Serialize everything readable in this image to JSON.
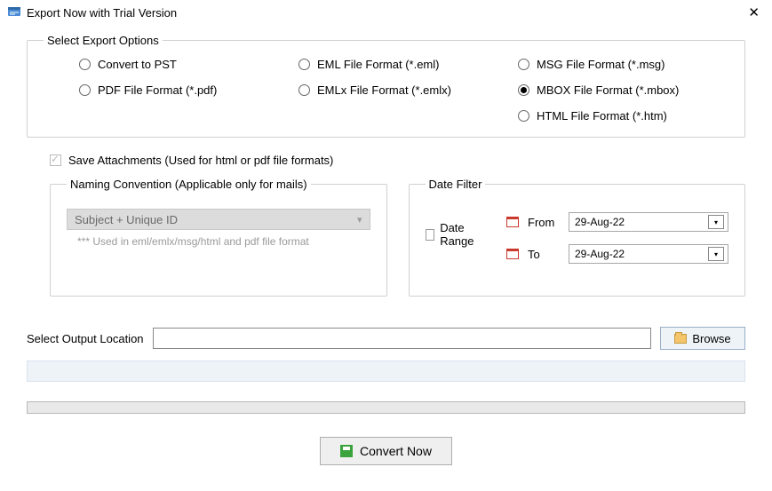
{
  "window": {
    "title": "Export Now with Trial Version"
  },
  "export": {
    "legend": "Select Export Options",
    "opts": {
      "pst": "Convert to PST",
      "pdf": "PDF File Format (*.pdf)",
      "eml": "EML File  Format (*.eml)",
      "emlx": "EMLx File  Format (*.emlx)",
      "msg": "MSG File Format (*.msg)",
      "mbox": "MBOX File Format (*.mbox)",
      "html": "HTML File  Format (*.htm)"
    }
  },
  "attachments": {
    "label": "Save Attachments (Used for html or pdf file formats)"
  },
  "naming": {
    "legend": "Naming Convention (Applicable only for mails)",
    "selected": "Subject + Unique ID",
    "note": "*** Used in eml/emlx/msg/html and pdf file format"
  },
  "datefilter": {
    "legend": "Date Filter",
    "range_label": "Date Range",
    "from_label": "From",
    "to_label": "To",
    "from_value": "29-Aug-22",
    "to_value": "29-Aug-22"
  },
  "output": {
    "label": "Select Output Location",
    "value": ""
  },
  "buttons": {
    "browse": "Browse",
    "convert": "Convert Now"
  }
}
